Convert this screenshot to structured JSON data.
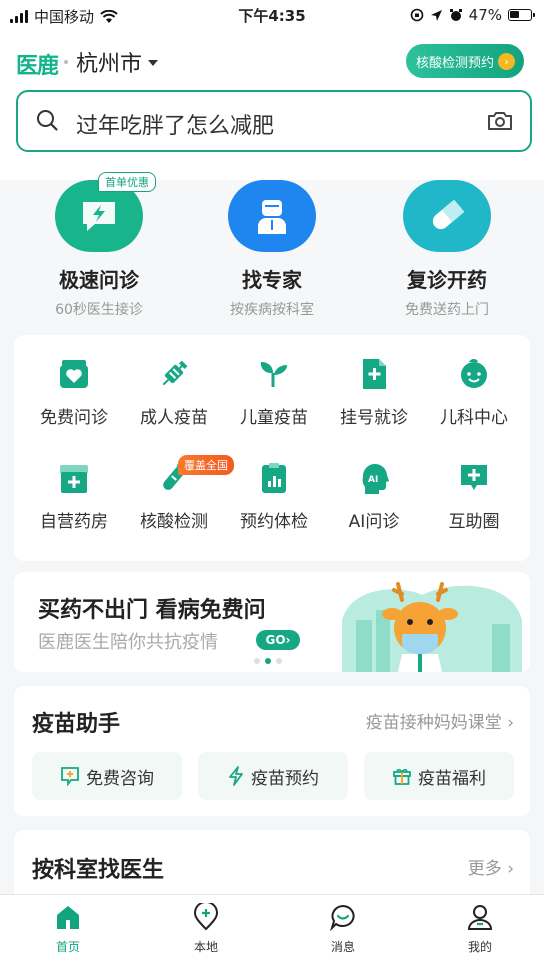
{
  "status_bar": {
    "carrier": "中国移动",
    "time": "下午4:35",
    "battery": "47%"
  },
  "header": {
    "logo": "医鹿",
    "city": "杭州市",
    "nucleic_button": "核酸检测预约",
    "search_placeholder": "过年吃胖了怎么减肥"
  },
  "main_services": [
    {
      "title": "极速问诊",
      "sub": "60秒医生接诊",
      "icon": "lightning-chat-icon",
      "color": "#18b48c"
    },
    {
      "title": "找专家",
      "sub": "按疾病按科室",
      "icon": "doctor-icon",
      "color": "#1f86f0"
    },
    {
      "title": "复诊开药",
      "sub": "免费送药上门",
      "icon": "pill-icon",
      "color": "#20b8c8"
    }
  ],
  "first_order_badge": "首单优惠",
  "grid": [
    {
      "label": "免费问诊",
      "icon": "heart-box-icon"
    },
    {
      "label": "成人疫苗",
      "icon": "syringe-icon"
    },
    {
      "label": "儿童疫苗",
      "icon": "sprout-icon"
    },
    {
      "label": "挂号就诊",
      "icon": "plus-document-icon"
    },
    {
      "label": "儿科中心",
      "icon": "child-face-icon"
    },
    {
      "label": "自营药房",
      "icon": "pharmacy-icon"
    },
    {
      "label": "核酸检测",
      "icon": "test-tube-icon"
    },
    {
      "label": "预约体检",
      "icon": "checkup-chart-icon"
    },
    {
      "label": "AI问诊",
      "icon": "ai-head-icon"
    },
    {
      "label": "互助圈",
      "icon": "plus-chat-icon"
    }
  ],
  "nationwide_badge": "覆盖全国",
  "banner": {
    "title": "买药不出门 看病免费问",
    "sub": "医鹿医生陪你共抗疫情",
    "go": "GO"
  },
  "vaccine": {
    "title": "疫苗助手",
    "link": "疫苗接种妈妈课堂",
    "buttons": [
      {
        "label": "免费咨询",
        "icon": "plus-chat-icon"
      },
      {
        "label": "疫苗预约",
        "icon": "lightning-icon"
      },
      {
        "label": "疫苗福利",
        "icon": "gift-icon"
      }
    ]
  },
  "dept": {
    "title": "按科室找医生",
    "more": "更多"
  },
  "tabbar": [
    {
      "label": "首页",
      "icon": "home-icon",
      "active": true
    },
    {
      "label": "本地",
      "icon": "location-plus-icon",
      "active": false
    },
    {
      "label": "消息",
      "icon": "chat-bubble-icon",
      "active": false
    },
    {
      "label": "我的",
      "icon": "person-icon",
      "active": false
    }
  ],
  "colors": {
    "brand": "#13a37f",
    "accent_orange": "#f15a22"
  }
}
